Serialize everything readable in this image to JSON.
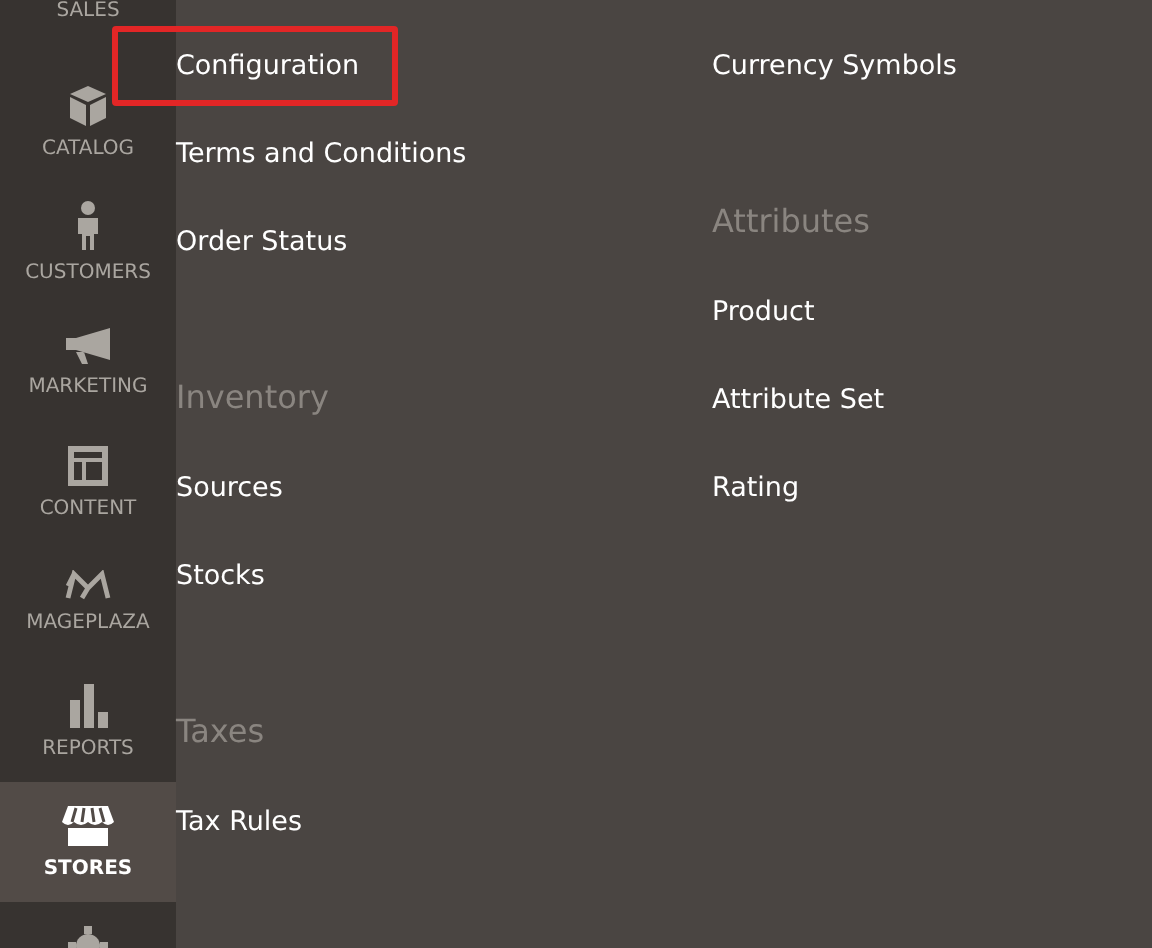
{
  "sidebar": {
    "items": [
      {
        "label": "SALES",
        "selected": false
      },
      {
        "label": "CATALOG",
        "selected": false
      },
      {
        "label": "CUSTOMERS",
        "selected": false
      },
      {
        "label": "MARKETING",
        "selected": false
      },
      {
        "label": "CONTENT",
        "selected": false
      },
      {
        "label": "MAGEPLAZA",
        "selected": false
      },
      {
        "label": "REPORTS",
        "selected": false
      },
      {
        "label": "STORES",
        "selected": true
      },
      {
        "selected": false
      }
    ]
  },
  "menu": {
    "columns": [
      {
        "sections": [
          {
            "links": [
              {
                "label": "Configuration",
                "outlined": true
              },
              {
                "label": "Terms and Conditions",
                "outlined": false
              },
              {
                "label": "Order Status",
                "outlined": false
              }
            ]
          },
          {
            "heading": "Inventory",
            "links": [
              {
                "label": "Sources",
                "outlined": false
              },
              {
                "label": "Stocks",
                "outlined": false
              }
            ]
          },
          {
            "heading": "Taxes",
            "links": [
              {
                "label": "Tax Rules",
                "outlined": false
              }
            ]
          }
        ]
      },
      {
        "sections": [
          {
            "links": [
              {
                "label": "Currency Symbols",
                "outlined": false
              }
            ]
          },
          {
            "heading": "Attributes",
            "links": [
              {
                "label": "Product",
                "outlined": false
              },
              {
                "label": "Attribute Set",
                "outlined": false
              },
              {
                "label": "Rating",
                "outlined": false
              }
            ]
          }
        ]
      }
    ]
  }
}
